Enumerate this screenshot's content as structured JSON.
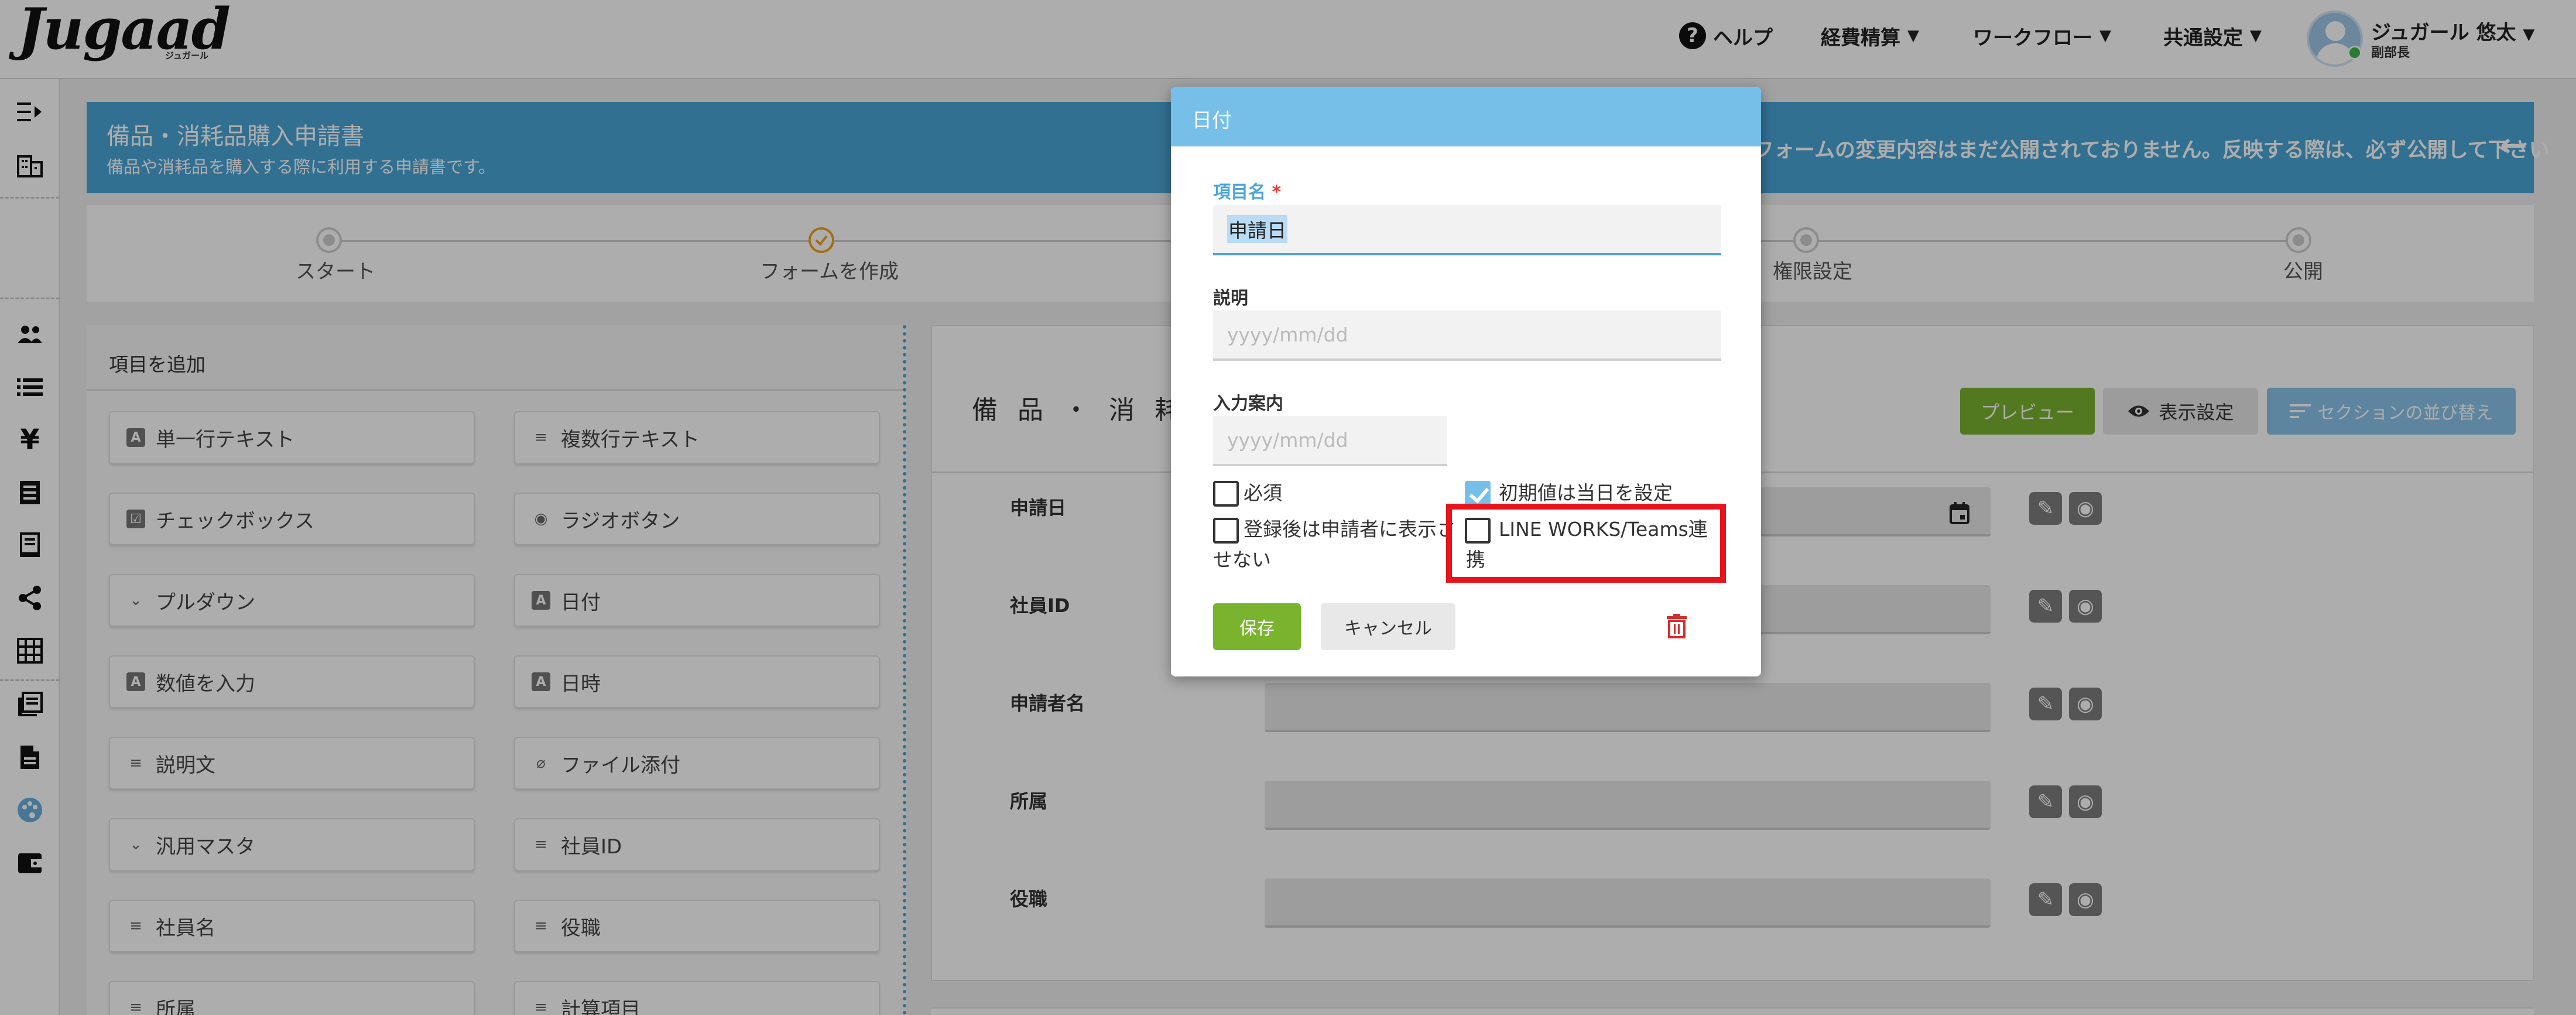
{
  "header": {
    "logo": "Jugaad",
    "logo_sub": "ジュガール",
    "help_label": "ヘルプ",
    "nav": [
      "経費精算",
      "ワークフロー",
      "共通設定"
    ],
    "user_name": "ジュガール 悠太",
    "user_role": "副部長"
  },
  "sidebar": {
    "icons": [
      "collapse-menu-icon",
      "building-icon",
      "users-icon",
      "list-icon",
      "yen-icon",
      "receipt-icon",
      "ledger-icon",
      "share-icon",
      "grid-icon",
      "library-icon",
      "document-icon",
      "palette-icon",
      "wallet-icon"
    ]
  },
  "banner": {
    "title": "備品・消耗品購入申請書",
    "subtitle": "備品や消耗品を購入する際に利用する申請書です。",
    "warning": "フォームの変更内容はまだ公開されておりません。反映する際は、必ず公開して下さい"
  },
  "steps": [
    "スタート",
    "フォームを作成",
    "権限設定",
    "公開"
  ],
  "palette": {
    "title": "項目を追加",
    "items": [
      {
        "label": "単一行テキスト",
        "icon": "A"
      },
      {
        "label": "複数行テキスト",
        "icon": "≡"
      },
      {
        "label": "チェックボックス",
        "icon": "☑"
      },
      {
        "label": "ラジオボタン",
        "icon": "◉"
      },
      {
        "label": "プルダウン",
        "icon": "⌄"
      },
      {
        "label": "日付",
        "icon": "A"
      },
      {
        "label": "数値を入力",
        "icon": "A"
      },
      {
        "label": "日時",
        "icon": "A"
      },
      {
        "label": "説明文",
        "icon": "≡"
      },
      {
        "label": "ファイル添付",
        "icon": "⌀"
      },
      {
        "label": "汎用マスタ",
        "icon": "⌄"
      },
      {
        "label": "社員ID",
        "icon": "≡"
      },
      {
        "label": "社員名",
        "icon": "≡"
      },
      {
        "label": "役職",
        "icon": "≡"
      },
      {
        "label": "所属",
        "icon": "≡"
      },
      {
        "label": "計算項目",
        "icon": "≡"
      }
    ]
  },
  "form": {
    "title": "備品・消耗",
    "preview_label": "プレビュー",
    "display_label": "表示設定",
    "sort_label": "セクションの並び替え",
    "rows": [
      "申請日",
      "社員ID",
      "申請者名",
      "所属",
      "役職"
    ]
  },
  "modal": {
    "title": "日付",
    "name_label": "項目名",
    "name_value": "申請日",
    "desc_label": "説明",
    "desc_placeholder": "yyyy/mm/dd",
    "guide_label": "入力案内",
    "guide_placeholder": "yyyy/mm/dd",
    "required_label": "必須",
    "required_checked": false,
    "default_today_label": "初期値は当日を設定",
    "default_today_checked": true,
    "hide_after_label": "登録後は申請者に表示させない",
    "hide_after_checked": false,
    "lineworks_label": "LINE WORKS/Teams連携",
    "lineworks_checked": false,
    "save_label": "保存",
    "cancel_label": "キャンセル"
  },
  "colors": {
    "accent": "#4aa5d8",
    "modal_header": "#75bfe9",
    "save_green": "#7ab32e",
    "highlight_red": "#e8141c",
    "delete_red": "#d32f2f"
  }
}
